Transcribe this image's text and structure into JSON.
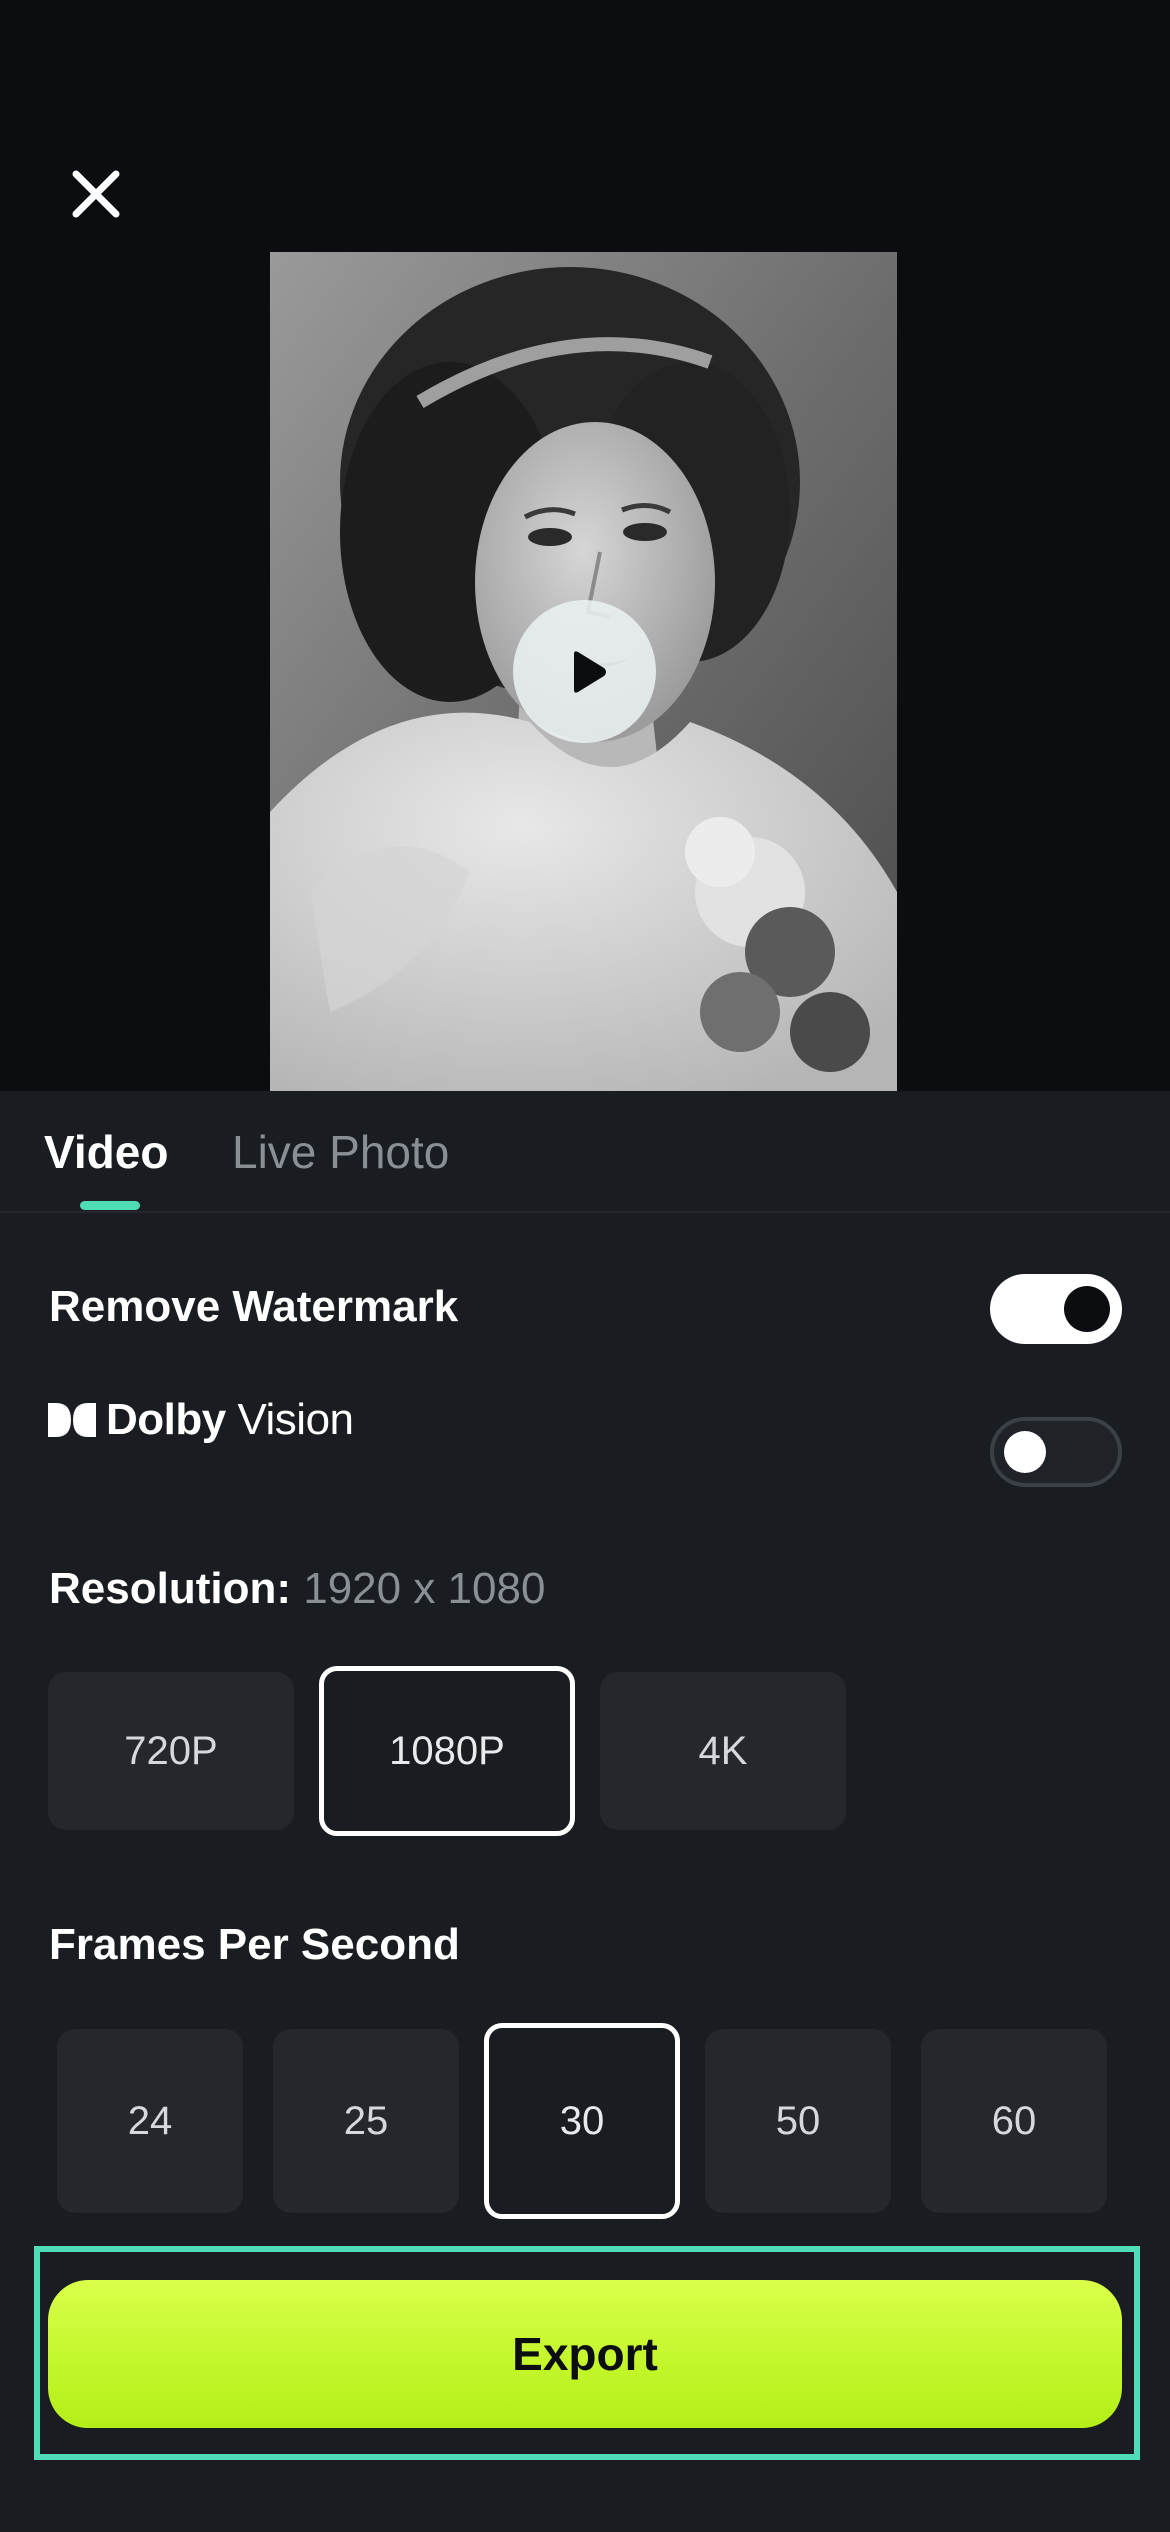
{
  "header": {
    "close_icon": "close-icon"
  },
  "preview": {
    "image": "black-and-white portrait photograph of a woman",
    "play_icon": "play-icon"
  },
  "tabs": [
    {
      "label": "Video",
      "selected": true
    },
    {
      "label": "Live Photo",
      "selected": false
    }
  ],
  "settings": {
    "remove_watermark": {
      "label": "Remove Watermark",
      "enabled": true
    },
    "dolby_vision": {
      "brand": "Dolby",
      "product": "Vision",
      "enabled": false
    },
    "resolution": {
      "label": "Resolution:",
      "value": "1920 x 1080",
      "options": [
        "720P",
        "1080P",
        "4K"
      ],
      "selected": "1080P"
    },
    "fps": {
      "label": "Frames Per Second",
      "options": [
        "24",
        "25",
        "30",
        "50",
        "60"
      ],
      "selected": "30"
    }
  },
  "export_button": {
    "label": "Export"
  },
  "colors": {
    "background": "#0b0d10",
    "sheet": "#191c20",
    "accent": "#4fdcb6",
    "export": "#c4f72c"
  }
}
